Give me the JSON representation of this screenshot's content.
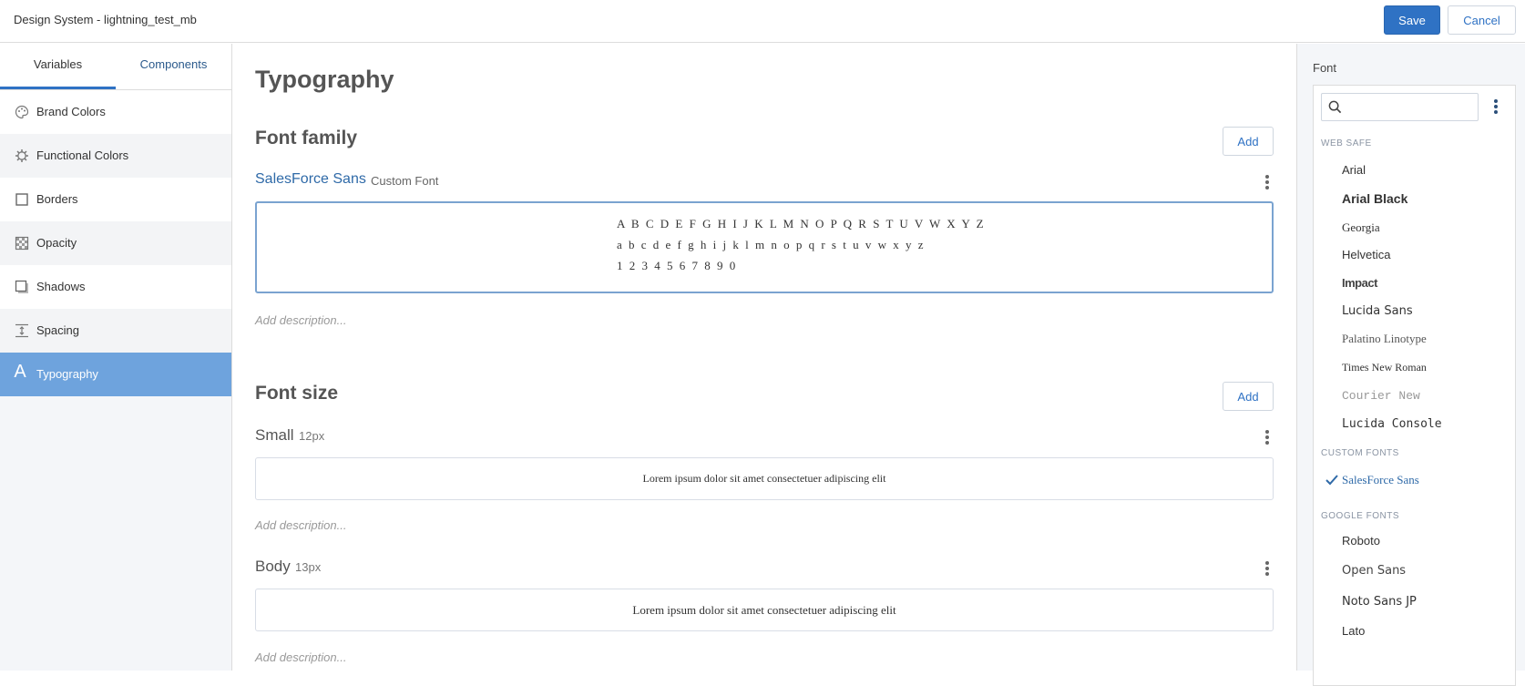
{
  "app": {
    "title": "Design System - lightning_test_mb"
  },
  "toolbar": {
    "save_label": "Save",
    "cancel_label": "Cancel"
  },
  "sidebar": {
    "tabs": [
      {
        "label": "Variables",
        "active": true
      },
      {
        "label": "Components"
      }
    ],
    "items": [
      {
        "label": "Brand Colors",
        "icon": "palette-icon"
      },
      {
        "label": "Functional Colors",
        "icon": "gear-icon"
      },
      {
        "label": "Borders",
        "icon": "square-icon"
      },
      {
        "label": "Opacity",
        "icon": "checker-icon"
      },
      {
        "label": "Shadows",
        "icon": "shadow-square-icon"
      },
      {
        "label": "Spacing",
        "icon": "spacing-icon"
      },
      {
        "label": "Typography",
        "icon": "letter-a-icon",
        "active": true
      }
    ],
    "active_color": "#6ea3dd"
  },
  "main": {
    "title": "Typography",
    "font_family": {
      "heading": "Font family",
      "add_label": "Add",
      "font_name": "SalesForce Sans",
      "font_type": "Custom Font",
      "specimen": [
        "A B C D E F G H I J K L M N O P Q R S T U V W X Y Z",
        "a b c d e f g h i j k l m n o p q r s t u v w x y z",
        "1 2 3 4 5 6 7 8 9 0"
      ],
      "description_placeholder": "Add description..."
    },
    "font_size": {
      "heading": "Font size",
      "add_label": "Add",
      "items": [
        {
          "name": "Small",
          "value": "12px",
          "preview": "Lorem ipsum dolor sit amet consectetuer adipiscing elit",
          "description_placeholder": "Add description..."
        },
        {
          "name": "Body",
          "value": "13px",
          "preview": "Lorem ipsum dolor sit amet consectetuer adipiscing elit",
          "description_placeholder": "Add description..."
        }
      ]
    }
  },
  "font_panel": {
    "title": "Font",
    "search": {
      "placeholder": "",
      "value": ""
    },
    "groups": [
      {
        "label": "WEB SAFE",
        "fonts": [
          "Arial",
          "Arial Black",
          "Georgia",
          "Helvetica",
          "Impact",
          "Lucida Sans",
          "Palatino Linotype",
          "Times New Roman",
          "Courier New",
          "Lucida Console"
        ]
      },
      {
        "label": "CUSTOM FONTS",
        "fonts": [
          "SalesForce Sans"
        ],
        "selected": "SalesForce Sans"
      },
      {
        "label": "GOOGLE FONTS",
        "fonts": [
          "Roboto",
          "Open Sans",
          "Noto Sans JP",
          "Lato"
        ]
      }
    ]
  },
  "colors": {
    "accent": "#2f72c4",
    "link": "#2f6aa8"
  }
}
